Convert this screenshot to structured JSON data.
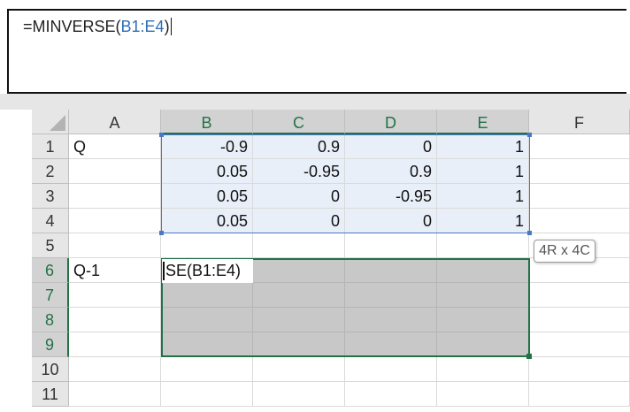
{
  "formula_bar": {
    "prefix": "=MINVERSE(",
    "reference": "B1:E4",
    "suffix": ")"
  },
  "columns": [
    {
      "label": "A",
      "selected": false
    },
    {
      "label": "B",
      "selected": true
    },
    {
      "label": "C",
      "selected": true
    },
    {
      "label": "D",
      "selected": true
    },
    {
      "label": "E",
      "selected": true
    },
    {
      "label": "F",
      "selected": false
    }
  ],
  "rows": [
    {
      "label": "1",
      "selected": false
    },
    {
      "label": "2",
      "selected": false
    },
    {
      "label": "3",
      "selected": false
    },
    {
      "label": "4",
      "selected": false
    },
    {
      "label": "5",
      "selected": false
    },
    {
      "label": "6",
      "selected": true
    },
    {
      "label": "7",
      "selected": true
    },
    {
      "label": "8",
      "selected": true
    },
    {
      "label": "9",
      "selected": true
    },
    {
      "label": "10",
      "selected": false
    },
    {
      "label": "11",
      "selected": false
    }
  ],
  "cells": {
    "A1": "Q",
    "A6": "Q-1",
    "matrix": [
      [
        "-0.9",
        "0.9",
        "0",
        "1"
      ],
      [
        "0.05",
        "-0.95",
        "0.9",
        "1"
      ],
      [
        "0.05",
        "0",
        "-0.95",
        "1"
      ],
      [
        "0.05",
        "0",
        "0",
        "1"
      ]
    ]
  },
  "editing_cell": {
    "text": "SE(B1:E4)"
  },
  "size_tooltip": "4R x 4C",
  "colors": {
    "reference_blue": "#2f6db5",
    "selection_green": "#217346",
    "source_range_fill": "#e9eff9",
    "array_range_fill": "#c8c8c8"
  }
}
